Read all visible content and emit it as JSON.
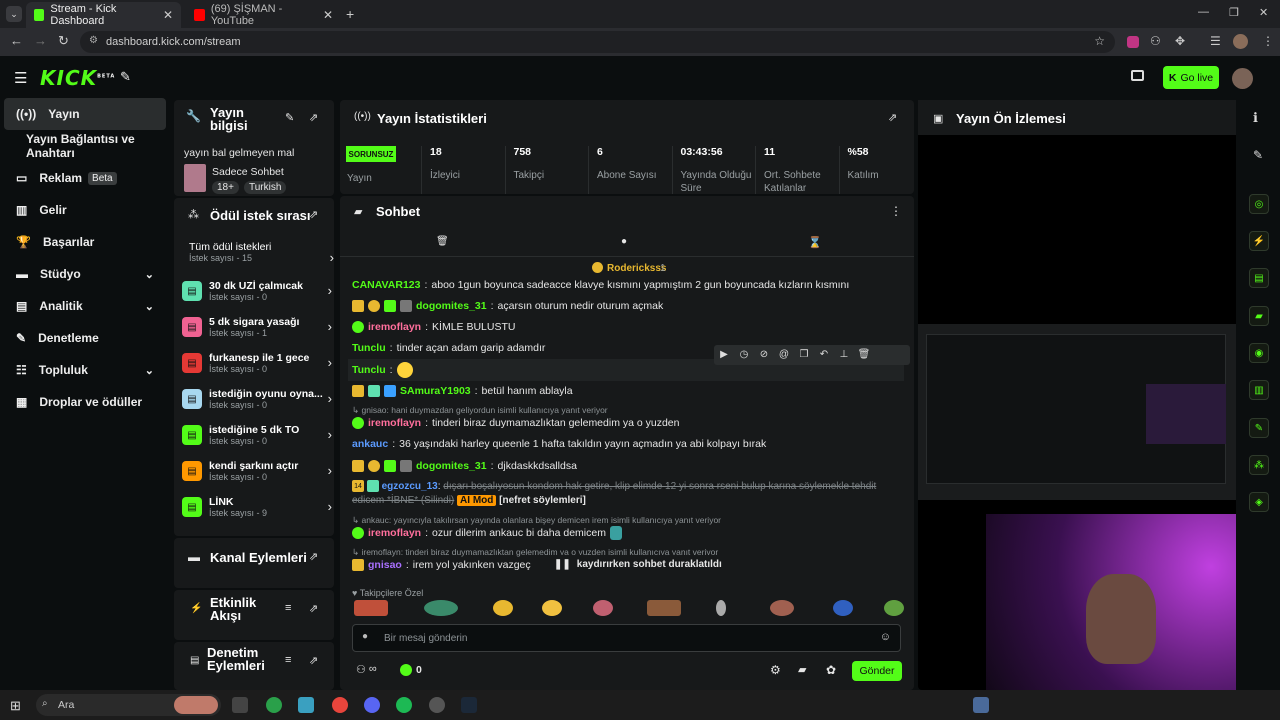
{
  "browser": {
    "tabs": [
      {
        "title": "Stream - Kick Dashboard"
      },
      {
        "title": "(69) ŞİŞMAN - YouTube"
      }
    ],
    "url": "dashboard.kick.com/stream"
  },
  "topnav": {
    "logo": "KICK",
    "logo_sup": "BETA",
    "go_live": "Go live"
  },
  "sidebar": {
    "items": [
      {
        "label": "Yayın"
      },
      {
        "label": "Yayın Bağlantısı ve Anahtarı"
      },
      {
        "label": "Reklam",
        "badge": "Beta"
      },
      {
        "label": "Gelir"
      },
      {
        "label": "Başarılar"
      },
      {
        "label": "Stüdyo"
      },
      {
        "label": "Analitik"
      },
      {
        "label": "Denetleme"
      },
      {
        "label": "Topluluk"
      },
      {
        "label": "Droplar ve ödüller"
      }
    ]
  },
  "stream_info": {
    "title": "Yayın bilgisi",
    "stream_title": "yayın bal gelmeyen mal",
    "category": "Sadece Sohbet",
    "tags": [
      "18+",
      "Turkish"
    ]
  },
  "rewards": {
    "title": "Ödül istek sırası",
    "all_label": "Tüm ödül istekleri",
    "all_count": "İstek sayısı - 15",
    "items": [
      {
        "name": "30 dk UZİ çalmıcak",
        "count": "İstek sayısı - 0",
        "color": "#5fe0b0"
      },
      {
        "name": "5 dk sigara yasağı",
        "count": "İstek sayısı - 1",
        "color": "#f06292"
      },
      {
        "name": "furkanesp ile 1 gece",
        "count": "İstek sayısı - 0",
        "color": "#e53935"
      },
      {
        "name": "istediğin oyunu oyna...",
        "count": "İstek sayısı - 0",
        "color": "#a8d8f0"
      },
      {
        "name": "istediğine 5 dk TO",
        "count": "İstek sayısı - 0",
        "color": "#53fc18"
      },
      {
        "name": "kendi şarkını açtır",
        "count": "İstek sayısı - 0",
        "color": "#ff9800"
      },
      {
        "name": "LİNK",
        "count": "İstek sayısı - 9",
        "color": "#53fc18"
      }
    ]
  },
  "channel_actions": {
    "title": "Kanal Eylemleri"
  },
  "activity": {
    "title": "Etkinlik Akışı"
  },
  "mod_actions": {
    "title": "Denetim Eylemleri"
  },
  "stats": {
    "title": "Yayın İstatistikleri",
    "status_badge": "SORUNSUZ",
    "status_label": "Yayın",
    "items": [
      {
        "value": "18",
        "label": "İzleyici"
      },
      {
        "value": "758",
        "label": "Takipçi"
      },
      {
        "value": "6",
        "label": "Abone Sayısı"
      },
      {
        "value": "03:43:56",
        "label": "Yayında Olduğu Süre"
      },
      {
        "value": "11",
        "label": "Ort. Sohbete Katılanlar"
      },
      {
        "value": "%58",
        "label": "Katılım"
      }
    ]
  },
  "chat": {
    "title": "Sohbet",
    "pinned_user": "Rodericksss",
    "pinned_count": "1",
    "messages": [
      {
        "user": "CANAVAR123",
        "text": "aboo 1gun boyunca sadeacce klavye kısmını yapmıştım 2 gun boyuncada kızların kısmını",
        "color": "#53fc18"
      },
      {
        "user": "dogomites_31",
        "text": "açarsın oturum nedir oturum açmak",
        "color": "#53fc18"
      },
      {
        "user": "iremoflayn",
        "text": "KİMLE BULUSTU",
        "color": "#ff6f9c"
      },
      {
        "user": "Tunclu",
        "text": "tinder açan adam garip adamdır",
        "color": "#53fc18"
      },
      {
        "user": "Tunclu",
        "text": "",
        "color": "#53fc18"
      },
      {
        "user": "SAmuraY1903",
        "text": "betül hanım ablayla",
        "color": "#53fc18"
      },
      {
        "reply": "gnisao: hani duymazdan geliyordun isimli kullanıcıya yanıt veriyor",
        "user": "iremoflayn",
        "text": "tinderi biraz duymamazlıktan gelemedim ya o yuzden",
        "color": "#ff6f9c"
      },
      {
        "user": "ankauc",
        "text": "36 yaşındaki harley queenle 1 hafta takıldın yayın açmadın ya abi kolpayı bırak",
        "color": "#5b9bff"
      },
      {
        "user": "dogomites_31",
        "text": "djkdaskkdsalldsa",
        "color": "#53fc18"
      },
      {
        "user": "egzozcu_13",
        "text": "dışarı boşalıyosun kondom hak getire, klip elimde 12 yi sonra rseni bulup karına söylemekle tehdit edicem *İBNE* (Silindi)",
        "extra": "AI Mod",
        "reason": "[nefret söylemleri]",
        "color": "#5b9bff"
      },
      {
        "reply": "ankauc: yayıncıyla takılırsan yayında olanlara bişey demicen irem isimli kullanıcıya yanıt veriyor",
        "user": "iremoflayn",
        "text": "ozur dilerim ankauc bi daha demicem",
        "color": "#ff6f9c"
      },
      {
        "reply": "iremoflayn: tinderi biraz duymamazlıktan gelemedim ya o yuzden isimli kullanıcıya yanıt veriyor",
        "user": "gnisao",
        "text": "irem yol yakınken vazgeç",
        "color": "#a970ff"
      }
    ],
    "paused": "kaydırırken sohbet duraklatıldı",
    "followers_only": "Takipçilere Özel",
    "input_placeholder": "Bir mesaj gönderin",
    "count_infinity": "∞",
    "points": "0",
    "send": "Gönder"
  },
  "preview": {
    "title": "Yayın Ön İzlemesi"
  },
  "taskbar": {
    "search": "Ara"
  }
}
